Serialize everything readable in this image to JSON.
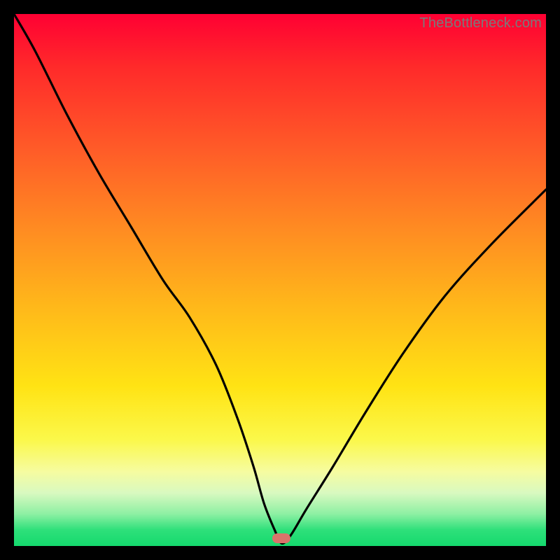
{
  "watermark": "TheBottleneck.com",
  "colors": {
    "frame": "#000000",
    "curve": "#000000",
    "marker": "#d9746b"
  },
  "marker": {
    "x_pct": 50.3,
    "y_pct": 98.5
  },
  "chart_data": {
    "type": "line",
    "title": "",
    "xlabel": "",
    "ylabel": "",
    "xlim": [
      0,
      100
    ],
    "ylim": [
      0,
      100
    ],
    "grid": false,
    "legend": false,
    "note": "Axes are unlabeled; values are percentage positions within the plot area, estimated from pixels. Lower y = bottom of plot (green / optimal).",
    "series": [
      {
        "name": "bottleneck-curve",
        "x": [
          0,
          4,
          10,
          16,
          22,
          28,
          33,
          38,
          42,
          45,
          47,
          49,
          50.3,
          52,
          55,
          60,
          66,
          73,
          81,
          90,
          100
        ],
        "y": [
          100,
          93,
          81,
          70,
          60,
          50,
          43,
          34,
          24,
          15,
          8,
          3,
          0.5,
          2,
          7,
          15,
          25,
          36,
          47,
          57,
          67
        ]
      }
    ]
  }
}
